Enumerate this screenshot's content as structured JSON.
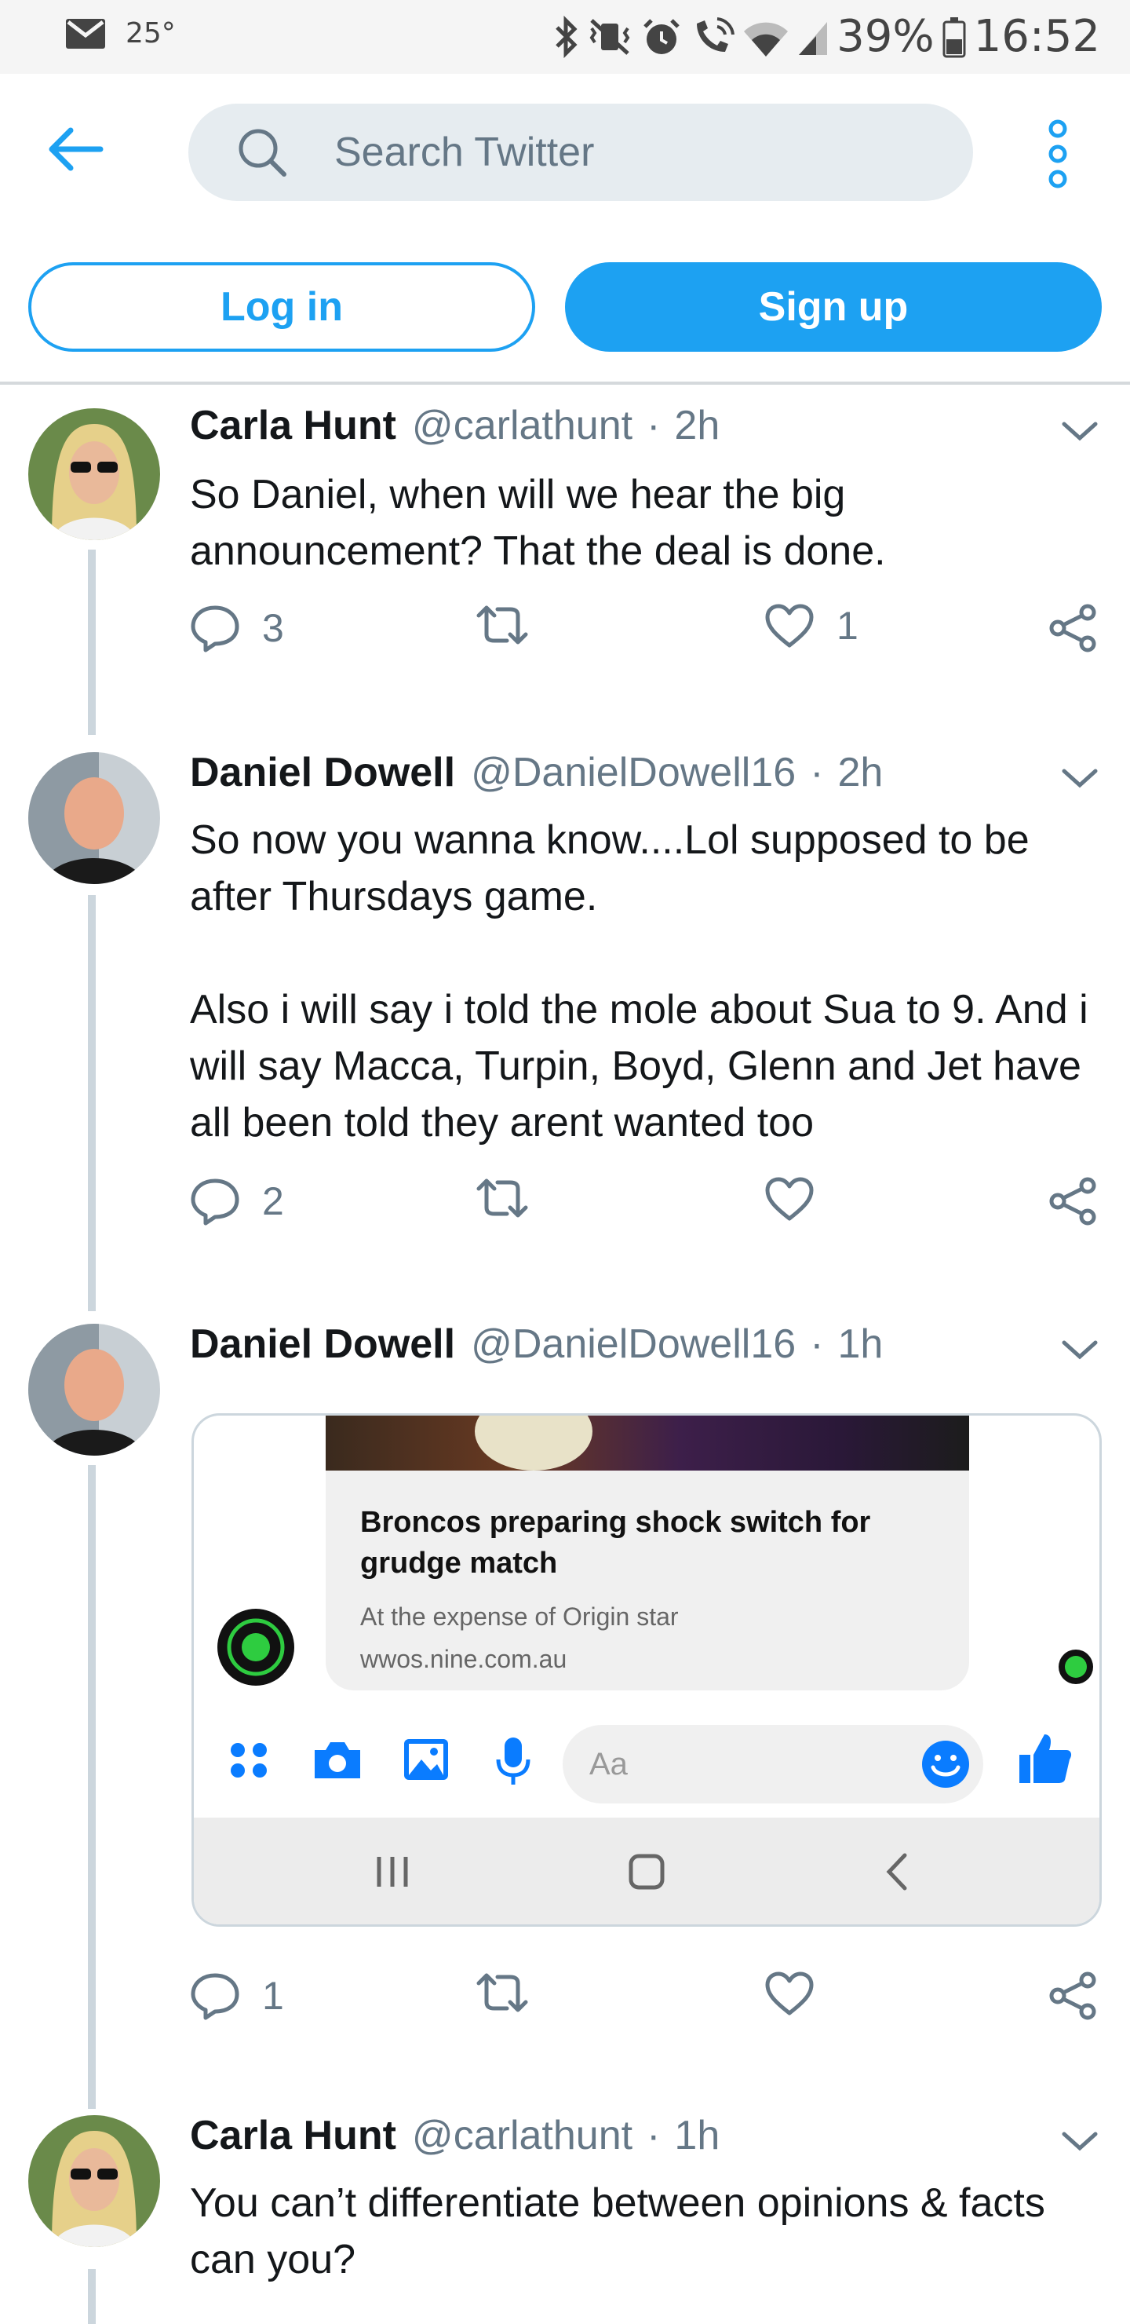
{
  "status_bar": {
    "temperature": "25°",
    "battery": "39%",
    "time": "16:52"
  },
  "header": {
    "search_placeholder": "Search Twitter",
    "login_label": "Log in",
    "signup_label": "Sign up"
  },
  "colors": {
    "accent": "#1da1f2",
    "thread_line": "#ccd6dd",
    "secondary_text": "#657786",
    "messenger_blue": "#0a7cff"
  },
  "tweets": [
    {
      "name": "Carla Hunt",
      "handle": "@carlathunt",
      "separator": "·",
      "time": "2h",
      "paragraphs": [
        "So Daniel, when will we hear the big announcement? That the deal is done."
      ],
      "replies": "3",
      "retweets": "",
      "likes": "1"
    },
    {
      "name": "Daniel Dowell",
      "handle": "@DanielDowell16",
      "separator": "·",
      "time": "2h",
      "paragraphs": [
        "So now you wanna know....Lol supposed to be after Thursdays game.",
        "Also i will say i told the mole about Sua to 9. And i will say Macca, Turpin, Boyd, Glenn and Jet have all been told they arent wanted too"
      ],
      "replies": "2",
      "retweets": "",
      "likes": ""
    },
    {
      "name": "Daniel Dowell",
      "handle": "@DanielDowell16",
      "separator": "·",
      "time": "1h",
      "card": {
        "title": "Broncos preparing shock switch for grudge match",
        "subtitle": "At the expense of Origin star",
        "domain": "wwos.nine.com.au",
        "message_placeholder": "Aa"
      },
      "replies": "1",
      "retweets": "",
      "likes": ""
    },
    {
      "name": "Carla Hunt",
      "handle": "@carlathunt",
      "separator": "·",
      "time": "1h",
      "paragraphs": [
        "You can’t differentiate between opinions & facts can you?"
      ]
    }
  ]
}
